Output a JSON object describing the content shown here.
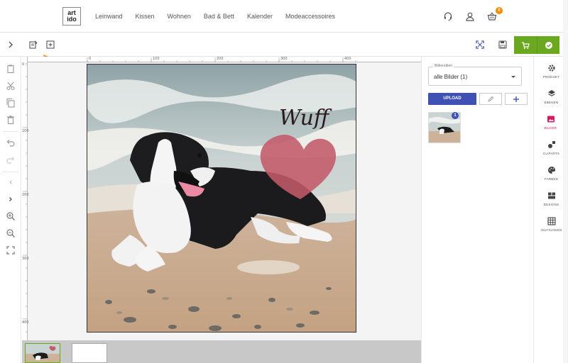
{
  "header": {
    "logo_line1": "art",
    "logo_line2": "ido",
    "nav": [
      "Leinwand",
      "Kissen",
      "Wohnen",
      "Bad & Bett",
      "Kalender",
      "Modeaccessoires"
    ],
    "cart_count": "0",
    "icons": [
      "headset-icon",
      "user-icon",
      "basket-icon"
    ]
  },
  "ruler": {
    "top_ticks": [
      "0",
      "100",
      "200",
      "300",
      "400"
    ],
    "left_ticks": [
      "0",
      "100",
      "200",
      "300",
      "400"
    ]
  },
  "photo": {
    "heart_text": "Wuff"
  },
  "right_panel": {
    "select_legend": "Bilderalben",
    "select_value": "alle Bilder (1)",
    "upload_label": "UPLOAD",
    "thumb_count": "1"
  },
  "sidebar": {
    "items": [
      {
        "label": "PRODUKT",
        "icon": "gear-icon"
      },
      {
        "label": "EBENEN",
        "icon": "layers-icon"
      },
      {
        "label": "BILDER",
        "icon": "image-icon"
      },
      {
        "label": "CLIPARTS",
        "icon": "cliparts-icon"
      },
      {
        "label": "FARBEN",
        "icon": "palette-icon"
      },
      {
        "label": "DESIGNS",
        "icon": "designs-icon"
      },
      {
        "label": "HILFSLINIEN",
        "icon": "grid-icon"
      }
    ],
    "active_index": 2
  },
  "colors": {
    "accent_green": "#6aa820",
    "accent_blue": "#3f51b5",
    "accent_pink": "#d81b60",
    "badge_orange": "#f08c00",
    "arrow_orange": "#f0902a"
  }
}
